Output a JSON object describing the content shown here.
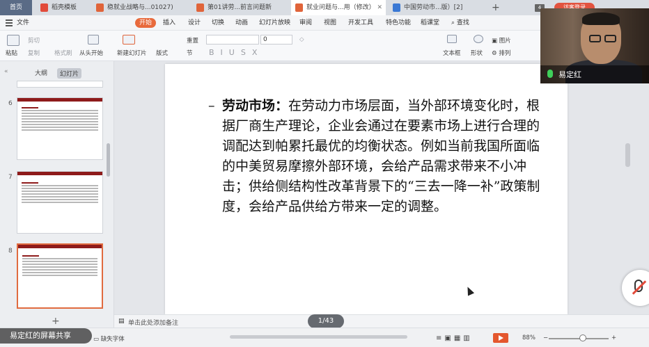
{
  "tabs": [
    {
      "label": "首页",
      "color": "#5a6b86"
    },
    {
      "label": "稻壳模板",
      "color": "#e24b3b"
    },
    {
      "label": "稳就业战略与...01027)",
      "color": "#e0643a"
    },
    {
      "label": "第01讲劳...前言问题新",
      "color": "#e0643a"
    },
    {
      "label": "就业问题与...用（修改）",
      "color": "#e0643a"
    },
    {
      "label": "中国劳动市...版）[2]",
      "color": "#3a78d4"
    }
  ],
  "tab_count": "4",
  "login_label": "访客登录",
  "menu": {
    "file": "文件",
    "items": [
      "开始",
      "插入",
      "设计",
      "切换",
      "动画",
      "幻灯片放映",
      "审阅",
      "视图",
      "开发工具",
      "特色功能",
      "稻课堂"
    ],
    "search": "查找"
  },
  "ribbon": {
    "paste": "粘贴",
    "cut": "剪切",
    "copy": "复制",
    "format_painter": "格式刷",
    "from_start": "从头开始",
    "new_slide": "新建幻灯片",
    "layout": "版式",
    "section": "节",
    "reset": "重置",
    "font_size": "0",
    "text_box": "文本框",
    "shape": "形状",
    "picture": "图片",
    "arrange": "排列"
  },
  "left_panel": {
    "outline_tab": "大纲",
    "slides_tab": "幻灯片",
    "slide_numbers": [
      "6",
      "7",
      "8"
    ],
    "add_slide": "+"
  },
  "slide": {
    "bullet": "–",
    "heading": "劳动市场：",
    "body": "在劳动力市场层面，当外部环境变化时，根据厂商生产理论，企业会通过在要素市场上进行合理的调配达到帕累托最优的均衡状态。例如当前我国所面临的中美贸易摩擦外部环境，会给产品需求带来不小冲击；供给侧结构性改革背景下的“三去一降一补”政策制度，会给产品供给方带来一定的调整。"
  },
  "notes_placeholder": "单击此处添加备注",
  "page_indicator": "1/43",
  "status": {
    "share_banner": "易定红的屏幕共享",
    "missing_font": "缺失字体",
    "zoom": "88%"
  },
  "webcam": {
    "name": "易定红"
  }
}
